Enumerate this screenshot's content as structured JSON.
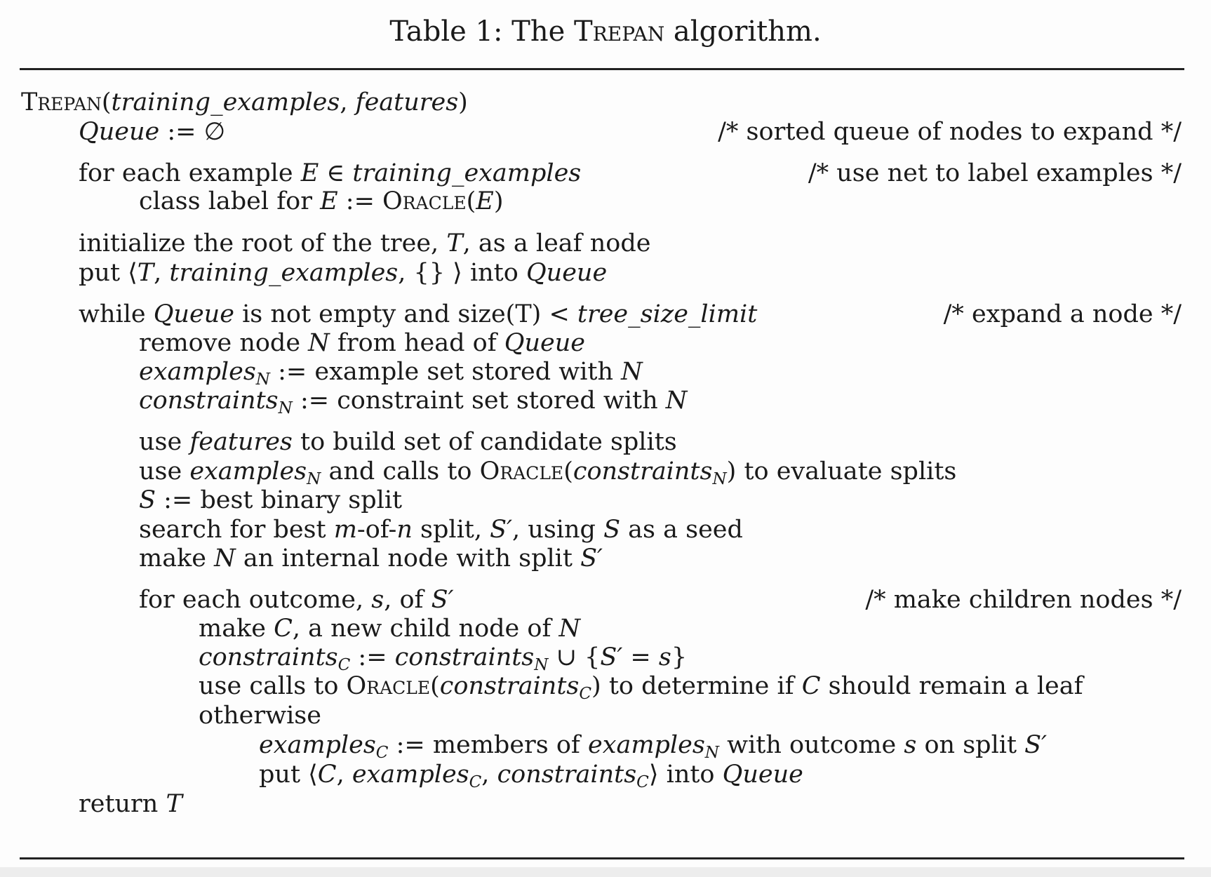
{
  "caption": "Table 1: The Trepan algorithm.",
  "lines": [
    {
      "indent": 0,
      "tokens": [
        {
          "t": "Trepan",
          "s": "sc"
        },
        {
          "t": "(",
          "s": ""
        },
        {
          "t": "training_examples",
          "s": "i"
        },
        {
          "t": ", ",
          "s": ""
        },
        {
          "t": "features",
          "s": "i"
        },
        {
          "t": ")",
          "s": ""
        }
      ]
    },
    {
      "indent": 1,
      "comment": "/* sorted queue of nodes to expand */",
      "tokens": [
        {
          "t": "Queue",
          "s": "i"
        },
        {
          "t": " := ∅",
          "s": ""
        }
      ]
    },
    {
      "indent": 1,
      "comment": "/* use net to label examples */",
      "tokens": [
        {
          "t": "for each example ",
          "s": ""
        },
        {
          "t": "E",
          "s": "i"
        },
        {
          "t": " ∈ ",
          "s": ""
        },
        {
          "t": "training_examples",
          "s": "i"
        }
      ]
    },
    {
      "indent": 2,
      "tokens": [
        {
          "t": "class label for ",
          "s": ""
        },
        {
          "t": "E",
          "s": "i"
        },
        {
          "t": " := ",
          "s": ""
        },
        {
          "t": "Oracle",
          "s": "sc"
        },
        {
          "t": "(",
          "s": ""
        },
        {
          "t": "E",
          "s": "i"
        },
        {
          "t": ")",
          "s": ""
        }
      ]
    },
    {
      "indent": 1,
      "tokens": [
        {
          "t": "initialize the root of the tree, ",
          "s": ""
        },
        {
          "t": "T",
          "s": "i"
        },
        {
          "t": ", as a leaf node",
          "s": ""
        }
      ]
    },
    {
      "indent": 1,
      "tokens": [
        {
          "t": "put ⟨",
          "s": ""
        },
        {
          "t": "T",
          "s": "i"
        },
        {
          "t": ", ",
          "s": ""
        },
        {
          "t": "training_examples",
          "s": "i"
        },
        {
          "t": ", {} ⟩ into ",
          "s": ""
        },
        {
          "t": "Queue",
          "s": "i"
        }
      ]
    },
    {
      "indent": 1,
      "comment": "/* expand a node */",
      "tokens": [
        {
          "t": "while ",
          "s": ""
        },
        {
          "t": "Queue",
          "s": "i"
        },
        {
          "t": " is not empty and size(T) < ",
          "s": ""
        },
        {
          "t": "tree_size_limit",
          "s": "i"
        }
      ]
    },
    {
      "indent": 2,
      "tokens": [
        {
          "t": "remove node ",
          "s": ""
        },
        {
          "t": "N",
          "s": "i"
        },
        {
          "t": " from head of ",
          "s": ""
        },
        {
          "t": "Queue",
          "s": "i"
        }
      ]
    },
    {
      "indent": 2,
      "tokens": [
        {
          "t": "examples",
          "s": "i"
        },
        {
          "t": "N",
          "s": "sub"
        },
        {
          "t": " := example set stored with ",
          "s": ""
        },
        {
          "t": "N",
          "s": "i"
        }
      ]
    },
    {
      "indent": 2,
      "tokens": [
        {
          "t": "constraints",
          "s": "i"
        },
        {
          "t": "N",
          "s": "sub"
        },
        {
          "t": " := constraint set stored with ",
          "s": ""
        },
        {
          "t": "N",
          "s": "i"
        }
      ]
    },
    {
      "indent": 2,
      "tokens": [
        {
          "t": "use ",
          "s": ""
        },
        {
          "t": "features",
          "s": "i"
        },
        {
          "t": " to build set of candidate splits",
          "s": ""
        }
      ]
    },
    {
      "indent": 2,
      "tokens": [
        {
          "t": "use ",
          "s": ""
        },
        {
          "t": "examples",
          "s": "i"
        },
        {
          "t": "N",
          "s": "sub"
        },
        {
          "t": " and calls to ",
          "s": ""
        },
        {
          "t": "Oracle",
          "s": "sc"
        },
        {
          "t": "(",
          "s": ""
        },
        {
          "t": "constraints",
          "s": "i"
        },
        {
          "t": "N",
          "s": "sub"
        },
        {
          "t": ") to evaluate splits",
          "s": ""
        }
      ]
    },
    {
      "indent": 2,
      "tokens": [
        {
          "t": "S",
          "s": "i"
        },
        {
          "t": " := best binary split",
          "s": ""
        }
      ]
    },
    {
      "indent": 2,
      "tokens": [
        {
          "t": "search for best ",
          "s": ""
        },
        {
          "t": "m",
          "s": "i"
        },
        {
          "t": "-of-",
          "s": ""
        },
        {
          "t": "n",
          "s": "i"
        },
        {
          "t": " split, ",
          "s": ""
        },
        {
          "t": "S′",
          "s": "i"
        },
        {
          "t": ", using ",
          "s": ""
        },
        {
          "t": "S",
          "s": "i"
        },
        {
          "t": " as a seed",
          "s": ""
        }
      ]
    },
    {
      "indent": 2,
      "tokens": [
        {
          "t": "make ",
          "s": ""
        },
        {
          "t": "N",
          "s": "i"
        },
        {
          "t": " an internal node with split ",
          "s": ""
        },
        {
          "t": "S′",
          "s": "i"
        }
      ]
    },
    {
      "indent": 2,
      "comment": "/* make children nodes */",
      "tokens": [
        {
          "t": "for each outcome, ",
          "s": ""
        },
        {
          "t": "s",
          "s": "i"
        },
        {
          "t": ", of ",
          "s": ""
        },
        {
          "t": "S′",
          "s": "i"
        }
      ]
    },
    {
      "indent": 3,
      "tokens": [
        {
          "t": "make ",
          "s": ""
        },
        {
          "t": "C",
          "s": "i"
        },
        {
          "t": ", a new child node of ",
          "s": ""
        },
        {
          "t": "N",
          "s": "i"
        }
      ]
    },
    {
      "indent": 3,
      "tokens": [
        {
          "t": "constraints",
          "s": "i"
        },
        {
          "t": "C",
          "s": "sub"
        },
        {
          "t": " := ",
          "s": ""
        },
        {
          "t": "constraints",
          "s": "i"
        },
        {
          "t": "N",
          "s": "sub"
        },
        {
          "t": " ∪ {",
          "s": ""
        },
        {
          "t": "S′",
          "s": "i"
        },
        {
          "t": " = ",
          "s": ""
        },
        {
          "t": "s",
          "s": "i"
        },
        {
          "t": "}",
          "s": ""
        }
      ]
    },
    {
      "indent": 3,
      "tokens": [
        {
          "t": "use calls to ",
          "s": ""
        },
        {
          "t": "Oracle",
          "s": "sc"
        },
        {
          "t": "(",
          "s": ""
        },
        {
          "t": "constraints",
          "s": "i"
        },
        {
          "t": "C",
          "s": "sub"
        },
        {
          "t": ") to determine if ",
          "s": ""
        },
        {
          "t": "C",
          "s": "i"
        },
        {
          "t": " should remain a leaf",
          "s": ""
        }
      ]
    },
    {
      "indent": 3,
      "tokens": [
        {
          "t": "otherwise",
          "s": ""
        }
      ]
    },
    {
      "indent": 4,
      "tokens": [
        {
          "t": "examples",
          "s": "i"
        },
        {
          "t": "C",
          "s": "sub"
        },
        {
          "t": " := members of ",
          "s": ""
        },
        {
          "t": "examples",
          "s": "i"
        },
        {
          "t": "N",
          "s": "sub"
        },
        {
          "t": " with outcome ",
          "s": ""
        },
        {
          "t": "s",
          "s": "i"
        },
        {
          "t": " on split ",
          "s": ""
        },
        {
          "t": "S′",
          "s": "i"
        }
      ]
    },
    {
      "indent": 4,
      "tokens": [
        {
          "t": "put ⟨",
          "s": ""
        },
        {
          "t": "C",
          "s": "i"
        },
        {
          "t": ", ",
          "s": ""
        },
        {
          "t": "examples",
          "s": "i"
        },
        {
          "t": "C",
          "s": "sub"
        },
        {
          "t": ", ",
          "s": ""
        },
        {
          "t": "constraints",
          "s": "i"
        },
        {
          "t": "C",
          "s": "sub"
        },
        {
          "t": "⟩ into ",
          "s": ""
        },
        {
          "t": "Queue",
          "s": "i"
        }
      ]
    },
    {
      "indent": 1,
      "tokens": [
        {
          "t": "return ",
          "s": ""
        },
        {
          "t": "T",
          "s": "i"
        }
      ]
    }
  ]
}
